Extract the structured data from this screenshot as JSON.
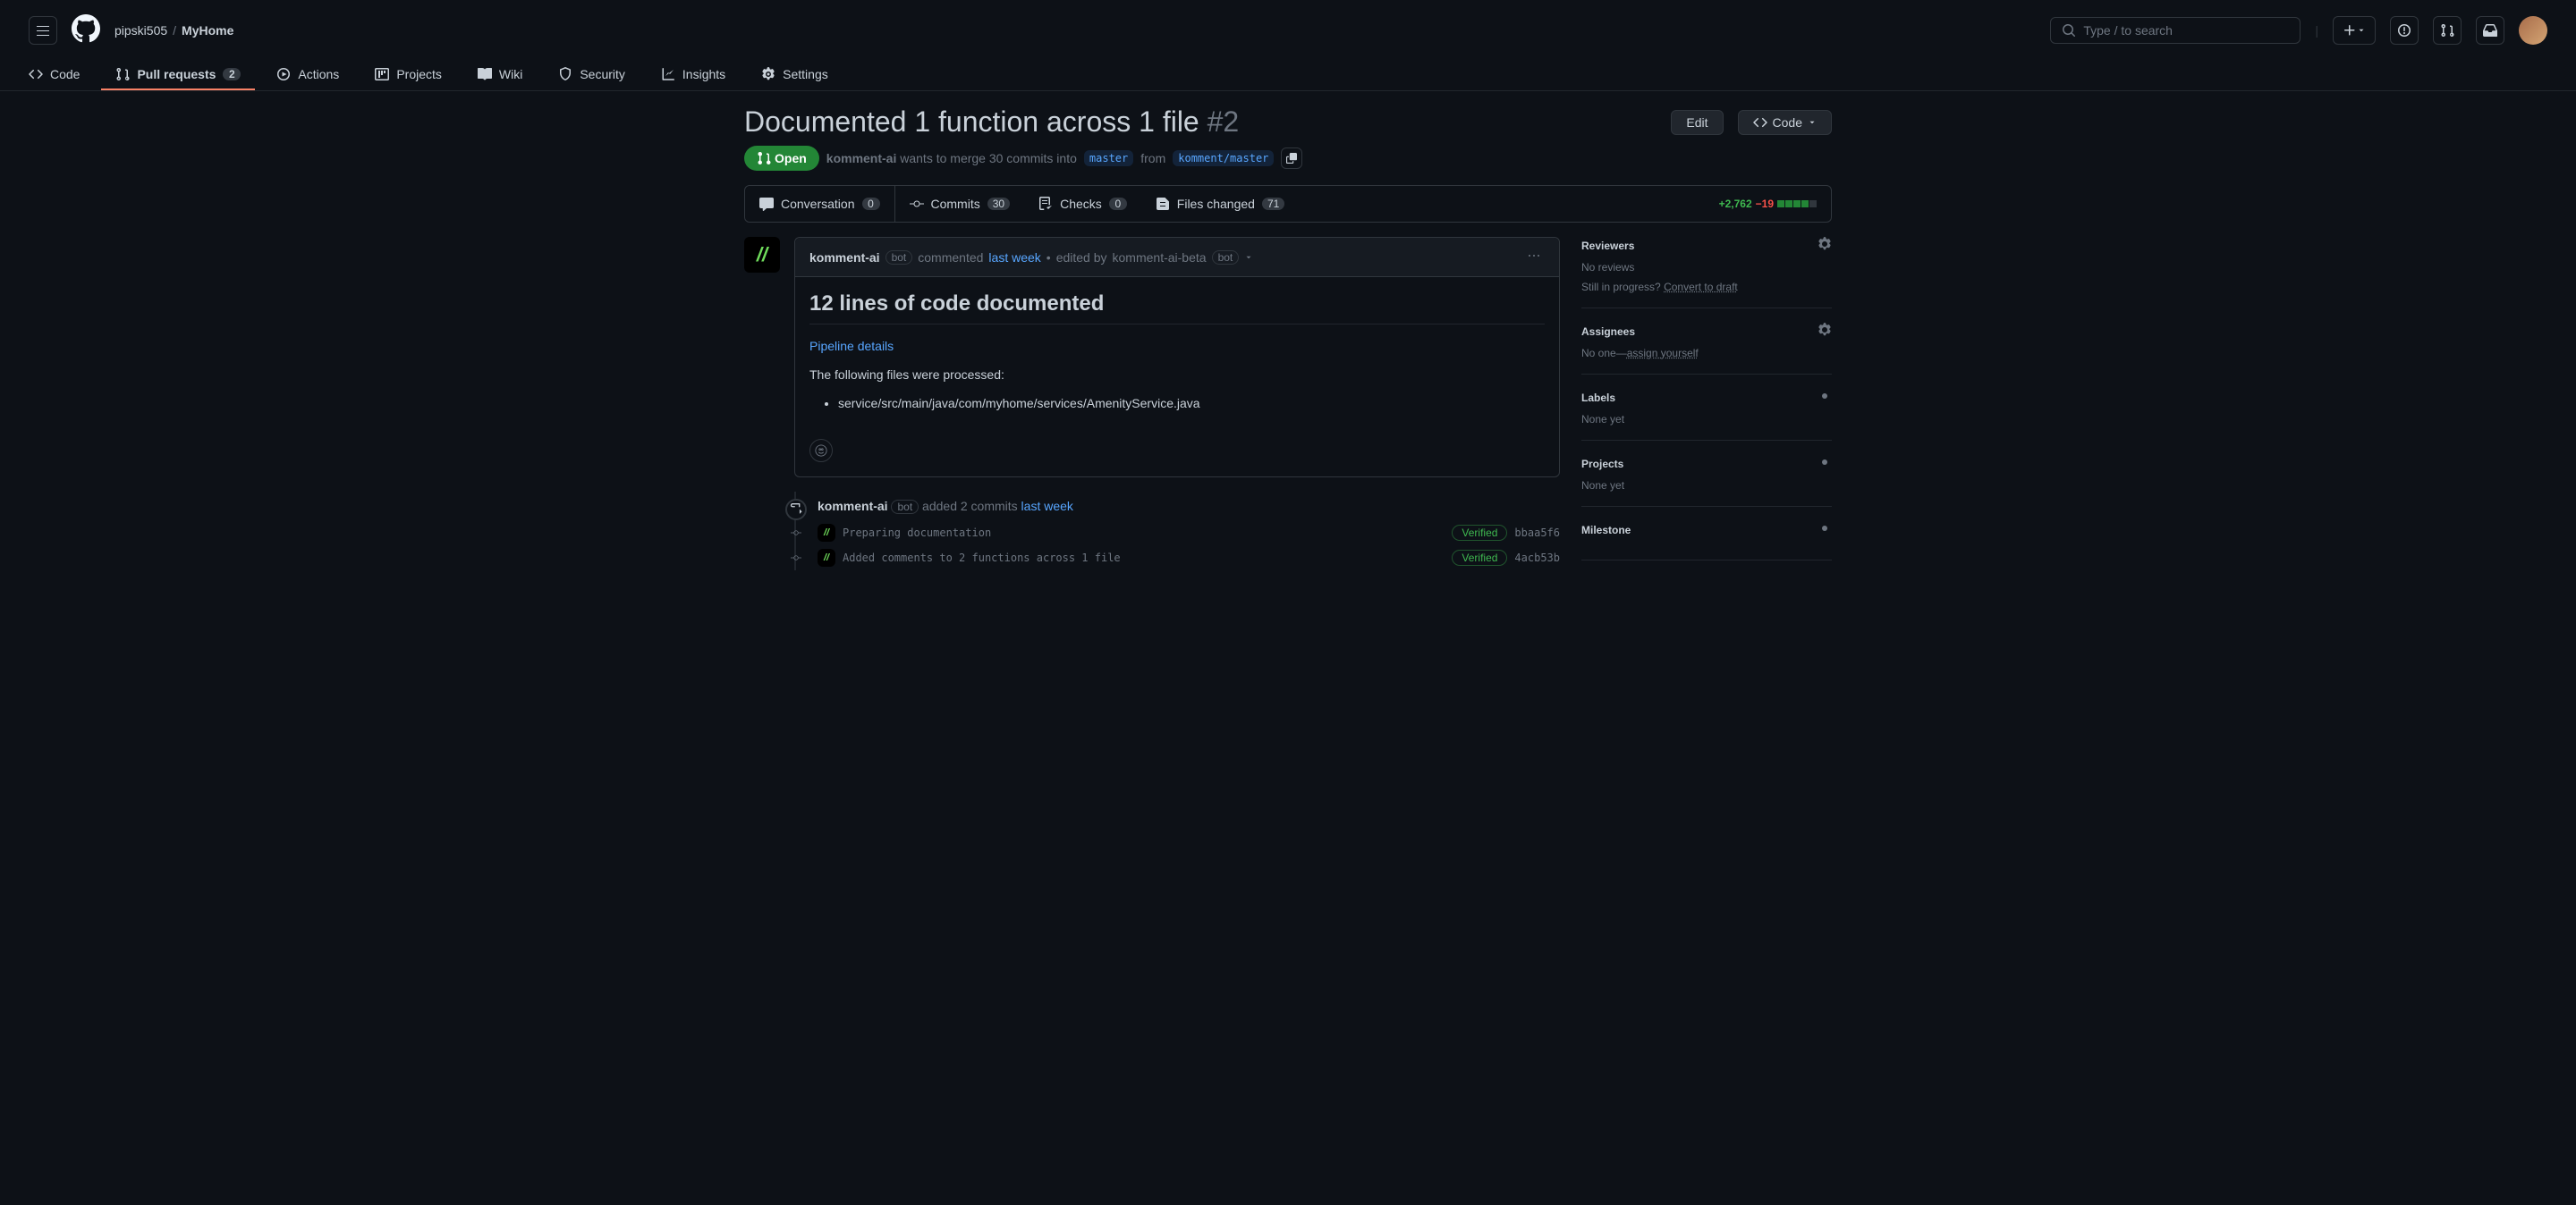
{
  "header": {
    "owner": "pipski505",
    "repo": "MyHome",
    "search_placeholder": "Type / to search"
  },
  "repo_nav": {
    "code": "Code",
    "pulls": "Pull requests",
    "pulls_count": "2",
    "actions": "Actions",
    "projects": "Projects",
    "wiki": "Wiki",
    "security": "Security",
    "insights": "Insights",
    "settings": "Settings"
  },
  "pr": {
    "title": "Documented 1 function across 1 file",
    "number": "#2",
    "edit": "Edit",
    "code_btn": "Code",
    "state": "Open",
    "author": "komment-ai",
    "meta_text": "wants to merge 30 commits into",
    "base_branch": "master",
    "from_text": "from",
    "head_branch": "komment/master"
  },
  "tabs": {
    "conversation": "Conversation",
    "conversation_count": "0",
    "commits": "Commits",
    "commits_count": "30",
    "checks": "Checks",
    "checks_count": "0",
    "files": "Files changed",
    "files_count": "71",
    "additions": "+2,762",
    "deletions": "−19"
  },
  "comment": {
    "author": "komment-ai",
    "bot": "bot",
    "commented": "commented",
    "time": "last week",
    "edited_by": "edited by",
    "editor": "komment-ai-beta",
    "editor_bot": "bot",
    "heading": "12 lines of code documented",
    "pipeline_link": "Pipeline details",
    "processed_text": "The following files were processed:",
    "file1": "service/src/main/java/com/myhome/services/AmenityService.java"
  },
  "timeline": {
    "author": "komment-ai",
    "bot": "bot",
    "added_text": "added 2 commits",
    "time": "last week",
    "commits": [
      {
        "msg": "Preparing documentation",
        "verified": "Verified",
        "sha": "bbaa5f6"
      },
      {
        "msg": "Added comments to 2 functions across 1 file",
        "verified": "Verified",
        "sha": "4acb53b"
      }
    ]
  },
  "sidebar": {
    "reviewers": {
      "title": "Reviewers",
      "body": "No reviews",
      "draft_q": "Still in progress?",
      "draft_link": "Convert to draft"
    },
    "assignees": {
      "title": "Assignees",
      "prefix": "No one—",
      "link": "assign yourself"
    },
    "labels": {
      "title": "Labels",
      "body": "None yet"
    },
    "projects": {
      "title": "Projects",
      "body": "None yet"
    },
    "milestone": {
      "title": "Milestone"
    }
  }
}
